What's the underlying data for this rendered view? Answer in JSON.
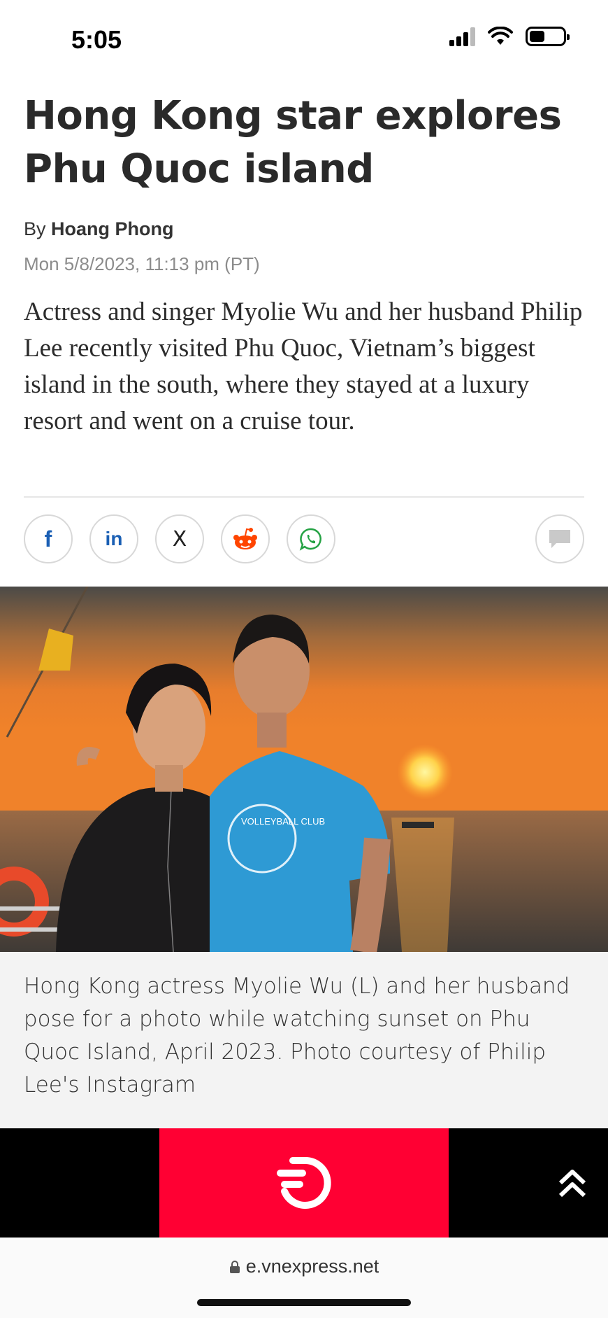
{
  "status_bar": {
    "time": "5:05",
    "signal_icon": "signal-bars-icon",
    "wifi_icon": "wifi-icon",
    "battery_icon": "battery-icon"
  },
  "article": {
    "headline": "Hong Kong star explores Phu Quoc island",
    "byline_prefix": "By",
    "author": "Hoang Phong",
    "date": "Mon 5/8/2023, 11:13 pm (PT)",
    "lead": "Actress and singer Myolie Wu and her husband Philip Lee recently visited Phu Quoc, Vietnam’s biggest island in the south, where they stayed at a luxury resort and went on a cruise tour."
  },
  "share": {
    "buttons": [
      {
        "name": "facebook",
        "icon": "facebook-icon",
        "label": "f",
        "color": "#1a5fb4"
      },
      {
        "name": "linkedin",
        "icon": "linkedin-icon",
        "label": "in",
        "color": "#1a5fb4"
      },
      {
        "name": "x",
        "icon": "x-icon",
        "label": "X",
        "color": "#222222"
      },
      {
        "name": "reddit",
        "icon": "reddit-icon",
        "label": "",
        "color": "#ff4500"
      },
      {
        "name": "whatsapp",
        "icon": "whatsapp-icon",
        "label": "",
        "color": "#25a244"
      }
    ],
    "comment_icon": "comment-icon"
  },
  "photo": {
    "shirt_text": "VOLLEYBALL CLUB",
    "caption": "Hong Kong actress Myolie Wu (L) and her husband pose for a photo while watching sunset on Phu Quoc Island, April 2023. Photo courtesy of Philip Lee's Instagram"
  },
  "ad": {
    "logo_icon": "brand-logo-icon",
    "scroll_top_icon": "double-chevron-up-icon",
    "accent": "#ff0033"
  },
  "browser": {
    "url": "e.vnexpress.net",
    "lock_icon": "lock-icon"
  }
}
